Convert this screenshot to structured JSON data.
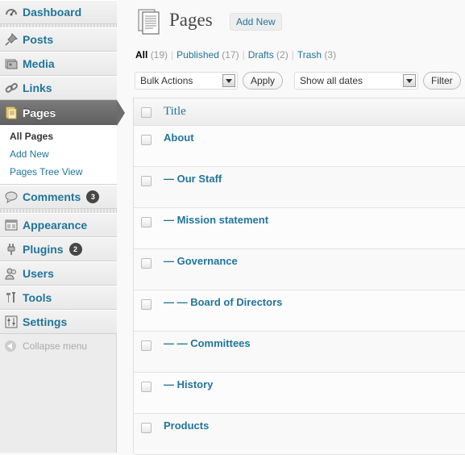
{
  "sidebar": {
    "menu": [
      {
        "key": "dashboard",
        "label": "Dashboard",
        "icon": "dashboard-icon"
      },
      {
        "key": "posts",
        "label": "Posts",
        "icon": "pushpin-icon"
      },
      {
        "key": "media",
        "label": "Media",
        "icon": "media-icon"
      },
      {
        "key": "links",
        "label": "Links",
        "icon": "link-icon"
      },
      {
        "key": "pages",
        "label": "Pages",
        "icon": "pages-icon",
        "active": true
      },
      {
        "key": "comments",
        "label": "Comments",
        "icon": "comment-icon",
        "badge": "3"
      },
      {
        "key": "appearance",
        "label": "Appearance",
        "icon": "appearance-icon"
      },
      {
        "key": "plugins",
        "label": "Plugins",
        "icon": "plugin-icon",
        "badge": "2"
      },
      {
        "key": "users",
        "label": "Users",
        "icon": "users-icon"
      },
      {
        "key": "tools",
        "label": "Tools",
        "icon": "tools-icon"
      },
      {
        "key": "settings",
        "label": "Settings",
        "icon": "settings-icon"
      }
    ],
    "pages_submenu": [
      "All Pages",
      "Add New",
      "Pages Tree View"
    ],
    "collapse_label": "Collapse menu"
  },
  "header": {
    "title": "Pages",
    "add_new": "Add New"
  },
  "filters": {
    "all": "All",
    "all_count": "(19)",
    "published": "Published",
    "published_count": "(17)",
    "drafts": "Drafts",
    "drafts_count": "(2)",
    "trash": "Trash",
    "trash_count": "(3)"
  },
  "toolbar": {
    "bulk_actions": "Bulk Actions",
    "apply": "Apply",
    "dates": "Show all dates",
    "filter": "Filter"
  },
  "table": {
    "column_title": "Title",
    "rows": [
      "About",
      "— Our Staff",
      "— Mission statement",
      "— Governance",
      "— — Board of Directors",
      "— — Committees",
      "— History",
      "Products"
    ]
  },
  "colors": {
    "link": "#21759b",
    "active_menu": "#6d6d6d",
    "badge": "#464646"
  }
}
